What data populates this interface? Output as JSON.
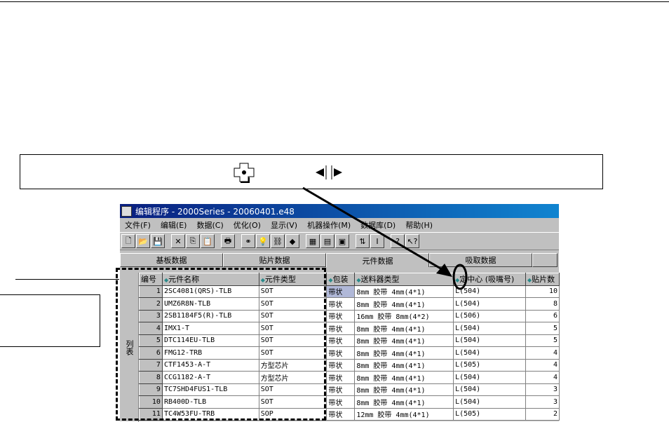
{
  "window": {
    "title": "编辑程序 - 2000Series - 20060401.e48"
  },
  "menu": [
    "文件(F)",
    "编辑(E)",
    "数据(C)",
    "优化(O)",
    "显示(V)",
    "机器操作(M)",
    "数据库(D)",
    "帮助(H)"
  ],
  "toolbar": [
    "new-icon",
    "open-icon",
    "save-icon",
    "cut-icon",
    "copy-icon",
    "paste-icon",
    "print-icon",
    "find-icon",
    "idea-icon",
    "network-icon",
    "shapes-icon",
    "grid-icon",
    "chip-icon",
    "box-icon",
    "swap-icon",
    "column-icon",
    "help-icon",
    "context-help-icon"
  ],
  "tabs": [
    "基板数据",
    "贴片数据",
    "元件数据",
    "吸取数据"
  ],
  "active_tab": "元件数据",
  "side_label": "列表",
  "columns": [
    "编号",
    "元件名称",
    "元件类型",
    "包装",
    "送料器类型",
    "定中心 (吸嘴号)",
    "贴片数"
  ],
  "rows": [
    [
      "1",
      "2SC4081(QRS)-TLB",
      "SOT",
      "带状",
      "8mm 胶带  4mm(4*1)",
      "L(504)",
      "10"
    ],
    [
      "2",
      "UMZ6R8N-TLB",
      "SOT",
      "带状",
      "8mm 胶带  4mm(4*1)",
      "L(504)",
      "8"
    ],
    [
      "3",
      "2SB1184F5(R)-TLB",
      "SOT",
      "带状",
      "16mm 胶带  8mm(4*2)",
      "L(506)",
      "6"
    ],
    [
      "4",
      "IMX1-T",
      "SOT",
      "带状",
      "8mm 胶带  4mm(4*1)",
      "L(504)",
      "5"
    ],
    [
      "5",
      "DTC114EU-TLB",
      "SOT",
      "带状",
      "8mm 胶带  4mm(4*1)",
      "L(504)",
      "5"
    ],
    [
      "6",
      "FMG12-TRB",
      "SOT",
      "带状",
      "8mm 胶带  4mm(4*1)",
      "L(504)",
      "4"
    ],
    [
      "7",
      "CTF1453-A-T",
      "方型芯片",
      "带状",
      "8mm 胶带  4mm(4*1)",
      "L(505)",
      "4"
    ],
    [
      "8",
      "CCG1182-A-T",
      "方型芯片",
      "带状",
      "8mm 胶带  4mm(4*1)",
      "L(504)",
      "4"
    ],
    [
      "9",
      "TC7SHD4FUS1-TLB",
      "SOT",
      "带状",
      "8mm 胶带  4mm(4*1)",
      "L(504)",
      "3"
    ],
    [
      "10",
      "RB400D-TLB",
      "SOT",
      "带状",
      "8mm 胶带  4mm(4*1)",
      "L(504)",
      "3"
    ],
    [
      "11",
      "TC4W53FU-TRB",
      "SOP",
      "带状",
      "12mm 胶带  4mm(4*1)",
      "L(505)",
      "2"
    ]
  ],
  "callout_icons": [
    "center-plus-icon",
    "split-arrows-icon"
  ]
}
